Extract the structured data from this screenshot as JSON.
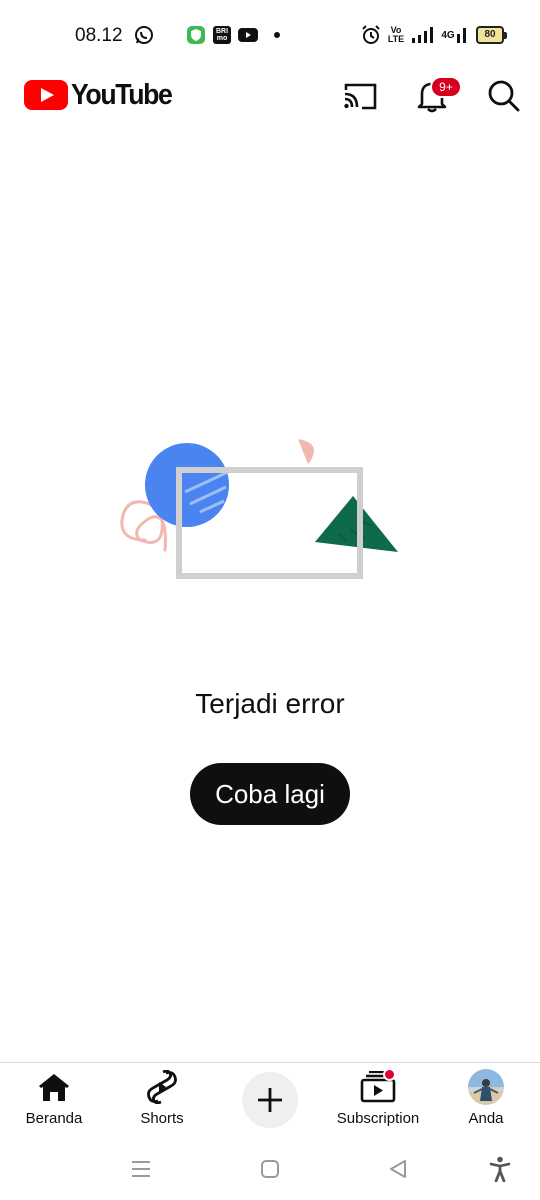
{
  "status_bar": {
    "time": "08.12",
    "brimo_label": "BRI mo",
    "volte_label": "Vo LTE",
    "network_label": "4G",
    "battery_level": "80"
  },
  "header": {
    "logo_text": "YouTube",
    "notification_count": "9+",
    "brand_color": "#ff0000"
  },
  "error": {
    "message": "Terjadi error",
    "retry_label": "Coba lagi"
  },
  "bottom_nav": {
    "items": [
      {
        "label": "Beranda",
        "icon": "home-icon"
      },
      {
        "label": "Shorts",
        "icon": "shorts-icon"
      },
      {
        "label": "",
        "icon": "create-icon"
      },
      {
        "label": "Subscription",
        "icon": "subscriptions-icon"
      },
      {
        "label": "Anda",
        "icon": "avatar"
      }
    ]
  },
  "system_nav": {
    "icons": [
      "menu-icon",
      "home-square-icon",
      "back-triangle-icon",
      "accessibility-icon"
    ]
  }
}
